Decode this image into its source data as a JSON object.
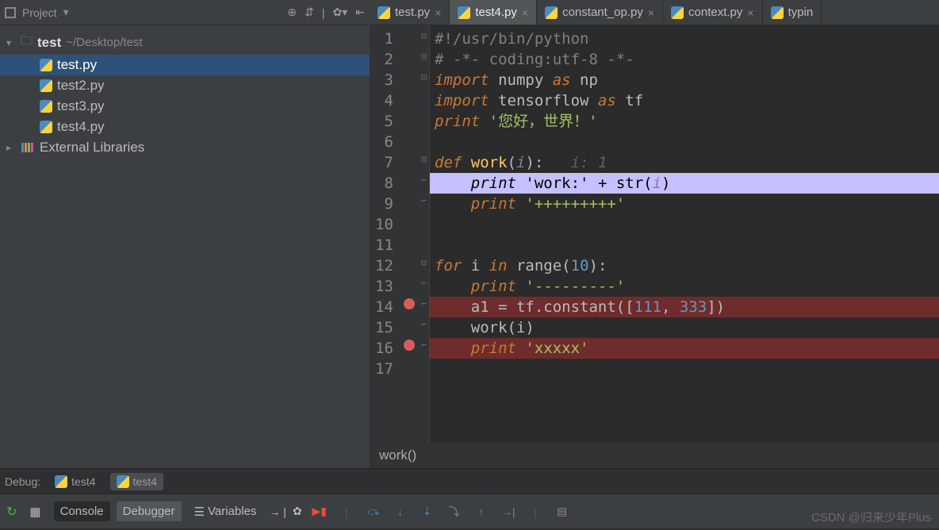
{
  "project_panel": {
    "title": "Project",
    "root_name": "test",
    "root_path": "~/Desktop/test",
    "files": [
      "test.py",
      "test2.py",
      "test3.py",
      "test4.py"
    ],
    "selected_file": "test.py",
    "external_libs": "External Libraries"
  },
  "tabs": [
    {
      "label": "test.py",
      "active": false
    },
    {
      "label": "test4.py",
      "active": true
    },
    {
      "label": "constant_op.py",
      "active": false
    },
    {
      "label": "context.py",
      "active": false
    },
    {
      "label": "typin",
      "active": false
    }
  ],
  "code": {
    "lines": [
      {
        "n": 1,
        "html": "<span class='cm'>#!/usr/bin/python</span>"
      },
      {
        "n": 2,
        "html": "<span class='cm'># -*- coding:utf-8 -*-</span>"
      },
      {
        "n": 3,
        "html": "<span class='kw'>import</span> numpy <span class='kw'>as</span> np"
      },
      {
        "n": 4,
        "html": "<span class='kw'>import</span> tensorflow <span class='kw'>as</span> tf"
      },
      {
        "n": 5,
        "html": "<span class='kw'>print</span> <span class='str'>'您好，世界！'</span>"
      },
      {
        "n": 6,
        "html": ""
      },
      {
        "n": 7,
        "html": "<span class='kw'>def</span> <span class='fn'>work</span>(<span class='pa'>i</span>):   <span class='hint'>i: 1</span>"
      },
      {
        "n": 8,
        "cls": "exec",
        "html": "    <span class='kw'>print</span> <span class='str'>'work:'</span> + str(<span class='pa'>i</span>)"
      },
      {
        "n": 9,
        "html": "    <span class='kw'>print</span> <span class='str'>'+++++++++'</span>"
      },
      {
        "n": 10,
        "html": ""
      },
      {
        "n": 11,
        "html": ""
      },
      {
        "n": 12,
        "html": "<span class='kw'>for</span> i <span class='kw'>in</span> range(<span class='num'>10</span>):"
      },
      {
        "n": 13,
        "html": "    <span class='kw'>print</span> <span class='str'>'---------'</span>"
      },
      {
        "n": 14,
        "cls": "bp",
        "bp": true,
        "html": "    a1 = tf.constant([<span class='num'>111</span>, <span class='num'>333</span>])"
      },
      {
        "n": 15,
        "html": "    work(i)"
      },
      {
        "n": 16,
        "cls": "bp",
        "bp": true,
        "html": "    <span class='kw'>print</span> <span class='str'>'xxxxx'</span>"
      },
      {
        "n": 17,
        "html": ""
      }
    ],
    "breadcrumb": "work()"
  },
  "debug": {
    "label": "Debug:",
    "configs": [
      "test4",
      "test4"
    ]
  },
  "bottom_tools": {
    "console": "Console",
    "debugger": "Debugger",
    "variables": "Variables"
  },
  "watermark": "CSDN @归来少年Plus"
}
